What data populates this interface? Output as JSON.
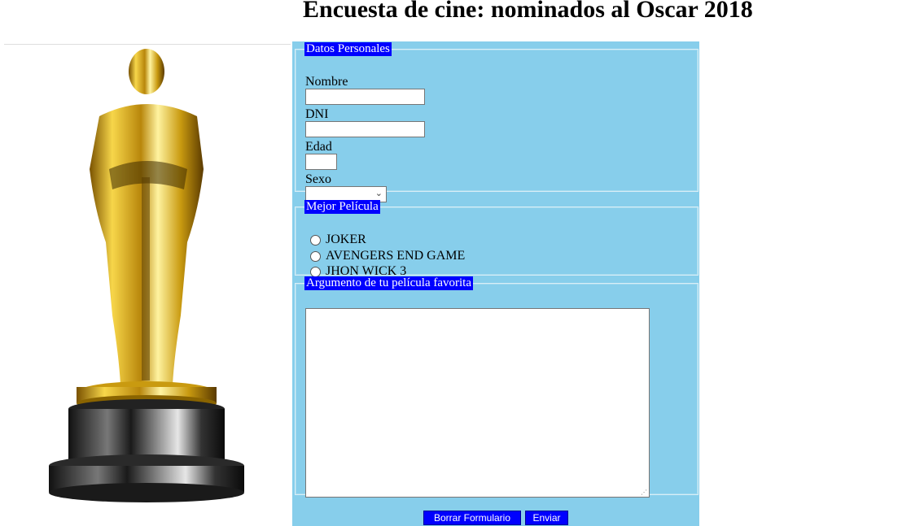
{
  "page": {
    "title": "Encuesta de cine: nominados al Oscar 2018"
  },
  "personal": {
    "legend": "Datos Personales",
    "nombre_label": "Nombre",
    "nombre_value": "",
    "dni_label": "DNI",
    "dni_value": "",
    "edad_label": "Edad",
    "edad_value": "",
    "sexo_label": "Sexo",
    "sexo_value": ""
  },
  "best_movie": {
    "legend": "Mejor Película",
    "options": [
      {
        "label": "JOKER",
        "selected": false
      },
      {
        "label": "AVENGERS END GAME",
        "selected": false
      },
      {
        "label": "JHON WICK 3",
        "selected": false
      }
    ]
  },
  "plot": {
    "legend": "Argumento de tu película favorita",
    "value": ""
  },
  "buttons": {
    "reset_label": "Borrar Formulario",
    "submit_label": "Enviar"
  },
  "image": {
    "icon": "oscar-statuette"
  },
  "colors": {
    "panel_bg": "#87ceeb",
    "legend_bg": "#0000ff",
    "button_bg": "#0000ff"
  }
}
